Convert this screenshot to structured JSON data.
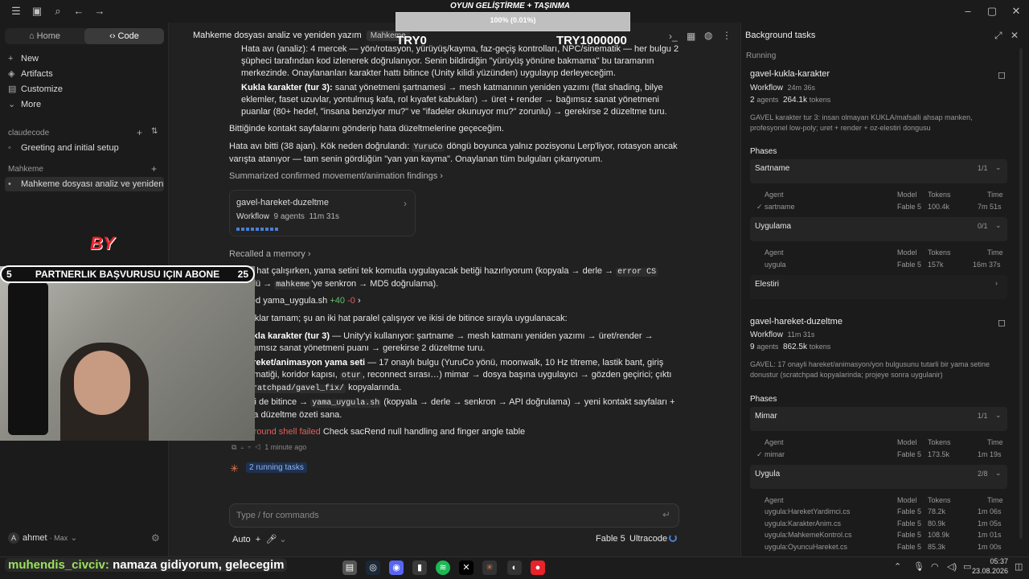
{
  "overlay": {
    "title": "OYUN GELİŞTİRME + TAŞINMA",
    "progress_text": "100% (0.01%)",
    "left_amount": "TRY0",
    "right_amount": "TRY1000000",
    "banner_text": "PARTNERLIK BAŞVURUSU IÇIN ABONE",
    "banner_left": "5",
    "banner_right": "25",
    "badge": "BY",
    "chat_user": "muhendis_civciv:",
    "chat_text": "namaza gidiyorum, gelecegim"
  },
  "sidebar": {
    "home": "Home",
    "code": "Code",
    "new": "New",
    "artifacts": "Artifacts",
    "customize": "Customize",
    "more": "More",
    "section1": "claudecode",
    "item1": "Greeting and initial setup",
    "section2": "Mahkeme",
    "item2": "Mahkeme dosyası analiz ve yeniden ya",
    "user": "ahmet",
    "plan": "· Max"
  },
  "main": {
    "title": "Mahkeme dosyası analiz ve yeniden yazım",
    "title_tag": "Mahkeme",
    "p1": "Hata avı (analiz): 4 mercek — yön/rotasyon, yürüyüş/kayma, faz-geçiş kontrolları, NPC/sinematik — her bulgu 2 şüpheci tarafından kod izlenerek doğrulanıyor. Senin bildirdiğin \"yürüyüş yönüne bakmama\" bu taramanın merkezinde. Onaylananları karakter hattı bitince (Unity kilidi yüzünden) uygulayıp derleyeceğim.",
    "p2a": "Kukla karakter (tur 3):",
    "p2b": " sanat yönetmeni şartnamesi → mesh katmanının yeniden yazımı (flat shading, bilye eklemler, faset uzuvlar, yontulmuş kafa, rol kıyafet kabukları) → üret + render → bağımsız sanat yönetmeni puanlar (80+ hedef, \"insana benziyor mu?\" ve \"ifadeler okunuyor mu?\" zorunlu) → gerekirse 2 düzeltme turu.",
    "p3": "Bittiğinde kontakt sayfalarını gönderip hata düzeltmelerine geçeceğim.",
    "p4a": "Hata avı bitti (38 ajan). Kök neden doğrulandı: ",
    "p4code": "YuruCo",
    "p4b": " döngü boyunca yalnız pozisyonu Lerp'liyor, rotasyon ancak varışta atanıyor — tam senin gördüğün \"yan yan kayma\". Onaylanan tüm bulguları çıkarıyorum.",
    "summ": "Summarized confirmed movement/animation findings",
    "card_title": "gavel-hareket-duzeltme",
    "card_kind": "Workflow",
    "card_agents": "9 agents",
    "card_time": "11m 31s",
    "recalled": "Recalled a memory",
    "p5a": "Her iki hat çalışırken, yama setini tek komutla uygulayacak betiği hazırlıyorum (kopyala → derle → ",
    "p5code1": "error CS",
    "p5b": " kontrolü → ",
    "p5code2": "mahkeme",
    "p5c": "'ye senkron → MD5 doğrulama).",
    "created": "Created yama_uygula.sh",
    "plus": "+40",
    "minus": "-0",
    "p6": "Hazırlıklar tamam; şu an iki hat paralel çalışıyor ve ikisi de bitince sırayla uygulanacak:",
    "l1a": "Kukla karakter (tur 3)",
    "l1b": " — Unity'yi kullanıyor: şartname → mesh katmanı yeniden yazımı → üret/render → bağımsız sanat yönetmeni puanı → gerekirse 2 düzeltme turu.",
    "l2a": "Hareket/animasyon yama seti",
    "l2b": " — 17 onaylı bulgu (YuruCo yönü, moonwalk, 10 Hz titreme, lastik bant, giriş otomatiği, koridor kapısı, ",
    "l2code": "otur",
    "l2c": ", reconnect sırası…) mimar → dosya başına uygulayıcı → gözden geçirici; çıktı ",
    "l2code2": "scratchpad/gavel_fix/",
    "l2d": " kopyalarında.",
    "p7a": "İkisi de bitince → ",
    "p7code": "yama_uygula.sh",
    "p7b": " (kopyala → derle → senkron → API doğrulama) → yeni kontakt sayfaları + hata düzeltme özeti sana.",
    "failed": "Background shell failed",
    "failed_desc": "Check sacRend null handling and finger angle table",
    "time_ago": "1 minute ago",
    "running": "2 running tasks",
    "input_placeholder": "Type / for commands",
    "auto": "Auto",
    "model": "Fable 5",
    "effort": "Ultracode"
  },
  "bg": {
    "title": "Background tasks",
    "running": "Running",
    "t1_name": "gavel-kukla-karakter",
    "t1_kind": "Workflow",
    "t1_time": "24m 36s",
    "t1_agents": "2",
    "t1_agents_word": "agents",
    "t1_tokens": "264.1k",
    "t1_tokens_word": "tokens",
    "t1_desc": "GAVEL karakter tur 3: insan olmayan KUKLA/mafsalli ahsap manken, profesyonel low-poly; uret + render + oz-elestiri dongusu",
    "phases": "Phases",
    "ph1": "Sartname",
    "ph1_count": "1/1",
    "ph2": "Uygulama",
    "ph2_count": "0/1",
    "ph3": "Elestiri",
    "col_agent": "Agent",
    "col_model": "Model",
    "col_tokens": "Tokens",
    "col_time": "Time",
    "ph1_row": [
      "sartname",
      "Fable 5",
      "100.4k",
      "7m 51s"
    ],
    "ph2_row": [
      "uygula",
      "Fable 5",
      "157k",
      "16m 37s"
    ],
    "t2_name": "gavel-hareket-duzeltme",
    "t2_kind": "Workflow",
    "t2_time": "11m 31s",
    "t2_agents": "9",
    "t2_agents_word": "agents",
    "t2_tokens": "862.5k",
    "t2_tokens_word": "tokens",
    "t2_desc": "GAVEL: 17 onayli hareket/animasyon/yon bulgusunu tutarli bir yama setine donustur (scratchpad kopyalarinda; projeye sonra uygulanir)",
    "ph4": "Mimar",
    "ph4_count": "1/1",
    "ph4_row": [
      "mimar",
      "Fable 5",
      "173.5k",
      "1m 19s"
    ],
    "ph5": "Uygula",
    "ph5_count": "2/8",
    "ph5_rows": [
      [
        "uygula:HareketYardimci.cs",
        "Fable 5",
        "78.2k",
        "1m 06s"
      ],
      [
        "uygula:KarakterAnim.cs",
        "Fable 5",
        "80.9k",
        "1m 05s"
      ],
      [
        "uygula:MahkemeKontrol.cs",
        "Fable 5",
        "108.9k",
        "1m 01s"
      ],
      [
        "uygula:OyuncuHareket.cs",
        "Fable 5",
        "85.3k",
        "1m 00s"
      ]
    ]
  },
  "taskbar": {
    "clock": "05:37",
    "date": "23.08.2026"
  }
}
